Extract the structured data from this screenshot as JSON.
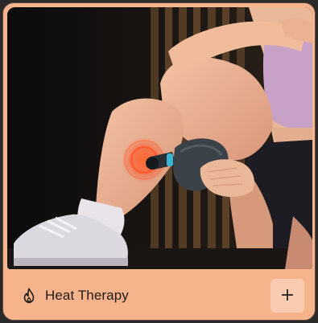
{
  "card": {
    "feature_label": "Heat Therapy",
    "feature_icon": "flame-icon",
    "add_button_glyph": "+",
    "add_button_icon": "plus-icon"
  },
  "colors": {
    "card_background": "#f7b48c",
    "add_button_background": "#f9cbb0",
    "label_color": "#1d1a18",
    "heat_glow": "#ff5a2a"
  }
}
